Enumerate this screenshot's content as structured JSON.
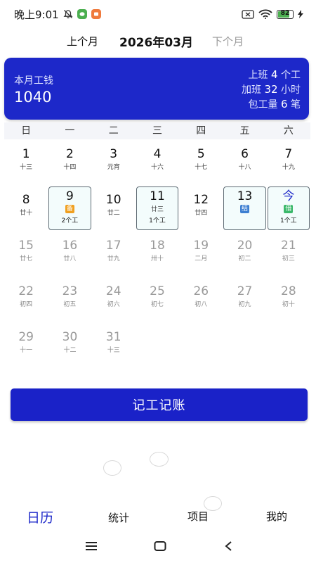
{
  "status_bar": {
    "time": "晚上9:01",
    "battery_level": "82",
    "icons": [
      "alarm-off-icon",
      "wechat-icon",
      "app-icon",
      "sim-off-icon",
      "wifi-icon",
      "battery-icon",
      "charging-icon"
    ],
    "accent_green": "#4caf50",
    "accent_orange": "#ef7a3d"
  },
  "month_nav": {
    "prev_label": "上个月",
    "current_month": "2026年03月",
    "next_label": "下个月"
  },
  "summary": {
    "wage_label": "本月工钱",
    "wage_value": "1040",
    "stats": [
      {
        "prefix": "上班",
        "value": "4",
        "suffix": "个工"
      },
      {
        "prefix": "加班",
        "value": "32",
        "suffix": "小时"
      },
      {
        "prefix": "包工量",
        "value": "6",
        "suffix": "笔"
      }
    ],
    "card_color": "#1d28c9"
  },
  "weekdays": [
    "日",
    "一",
    "二",
    "三",
    "四",
    "五",
    "六"
  ],
  "calendar": {
    "weeks": [
      [
        {
          "day": "1",
          "lunar": "十三"
        },
        {
          "day": "2",
          "lunar": "十四"
        },
        {
          "day": "3",
          "lunar": "元宵"
        },
        {
          "day": "4",
          "lunar": "十六"
        },
        {
          "day": "5",
          "lunar": "十七"
        },
        {
          "day": "6",
          "lunar": "十八"
        },
        {
          "day": "7",
          "lunar": "十九"
        }
      ],
      [
        {
          "day": "8",
          "lunar": "廿十"
        },
        {
          "day": "9",
          "tag": "备",
          "tag_color": "#f0a020",
          "work": "2个工",
          "boxed": true
        },
        {
          "day": "10",
          "lunar": "廿二"
        },
        {
          "day": "11",
          "lunar": "廿三",
          "work": "1个工",
          "boxed": true
        },
        {
          "day": "12",
          "lunar": "廿四"
        },
        {
          "day": "13",
          "tag": "结",
          "tag_color": "#3d7fd1",
          "boxed": true
        },
        {
          "day": "今",
          "tag": "借",
          "tag_color": "#3bb86a",
          "work": "1个工",
          "boxed": true,
          "today": true
        }
      ],
      [
        {
          "day": "15",
          "lunar": "廿七",
          "future": true
        },
        {
          "day": "16",
          "lunar": "廿八",
          "future": true
        },
        {
          "day": "17",
          "lunar": "廿九",
          "future": true
        },
        {
          "day": "18",
          "lunar": "卅十",
          "future": true
        },
        {
          "day": "19",
          "lunar": "二月",
          "future": true
        },
        {
          "day": "20",
          "lunar": "初二",
          "future": true
        },
        {
          "day": "21",
          "lunar": "初三",
          "future": true
        }
      ],
      [
        {
          "day": "22",
          "lunar": "初四",
          "future": true
        },
        {
          "day": "23",
          "lunar": "初五",
          "future": true
        },
        {
          "day": "24",
          "lunar": "初六",
          "future": true
        },
        {
          "day": "25",
          "lunar": "初七",
          "future": true
        },
        {
          "day": "26",
          "lunar": "初八",
          "future": true
        },
        {
          "day": "27",
          "lunar": "初九",
          "future": true
        },
        {
          "day": "28",
          "lunar": "初十",
          "future": true
        }
      ],
      [
        {
          "day": "29",
          "lunar": "十一",
          "future": true
        },
        {
          "day": "30",
          "lunar": "十二",
          "future": true
        },
        {
          "day": "31",
          "lunar": "十三",
          "future": true
        }
      ]
    ]
  },
  "record_button": {
    "label": "记工记账"
  },
  "bottom_nav": {
    "items": [
      {
        "label": "日历",
        "active": true
      },
      {
        "label": "统计"
      },
      {
        "label": "项目"
      },
      {
        "label": "我的"
      }
    ]
  },
  "system_nav": {
    "icons": [
      "menu-icon",
      "home-icon",
      "back-icon"
    ]
  }
}
